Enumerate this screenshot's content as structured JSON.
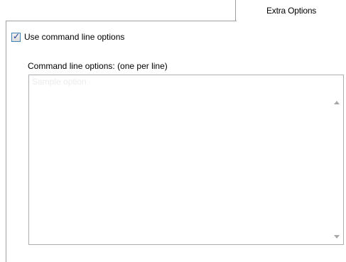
{
  "tabs": {
    "active_label": "Extra Options"
  },
  "options": {
    "use_cmdline_label": "Use command line options",
    "use_cmdline_checked": true,
    "cmdline_label": "Command line options:  (one per line)",
    "cmdline_value": "",
    "cmdline_placeholder": "Sample option"
  },
  "icons": {
    "scroll_up": "chevron-up-icon",
    "scroll_down": "chevron-down-icon",
    "check": "checkmark-icon"
  }
}
